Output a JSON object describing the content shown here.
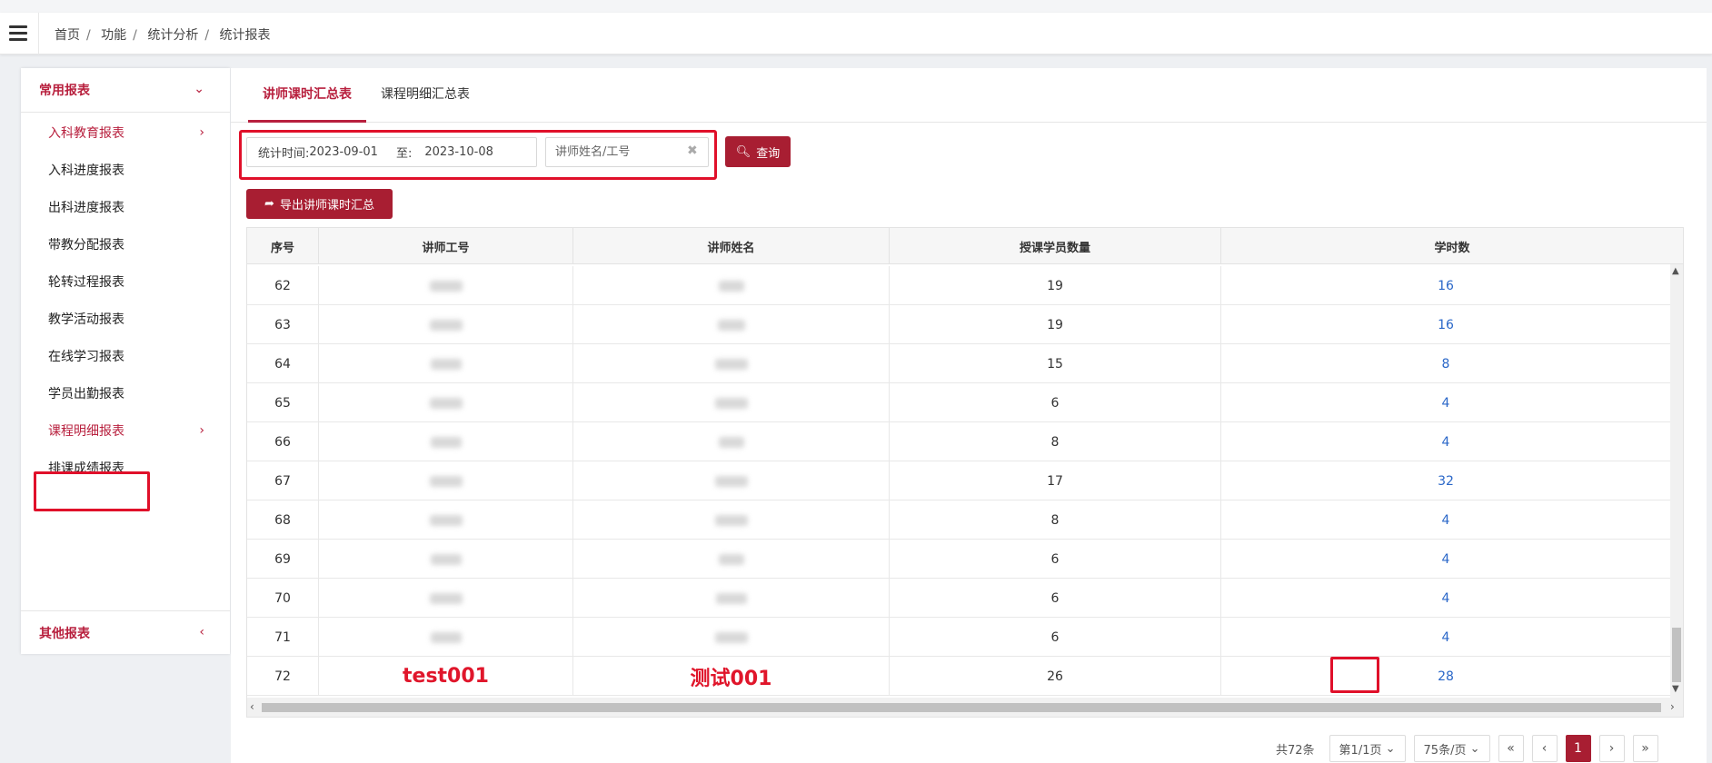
{
  "breadcrumb": [
    "首页",
    "功能",
    "统计分析",
    "统计报表"
  ],
  "sidebar": {
    "group1": "常用报表",
    "group2": "其他报表",
    "items": [
      {
        "label": "入科教育报表",
        "active": true,
        "arrow": true
      },
      {
        "label": "入科进度报表"
      },
      {
        "label": "出科进度报表"
      },
      {
        "label": "带教分配报表"
      },
      {
        "label": "轮转过程报表"
      },
      {
        "label": "教学活动报表"
      },
      {
        "label": "在线学习报表"
      },
      {
        "label": "学员出勤报表"
      },
      {
        "label": "课程明细报表",
        "active": true,
        "arrow": true,
        "highlighted": true
      },
      {
        "label": "排课成绩报表"
      }
    ]
  },
  "tabs": [
    {
      "label": "讲师课时汇总表",
      "active": true
    },
    {
      "label": "课程明细汇总表"
    }
  ],
  "filter": {
    "date_label": "统计时间:",
    "start_date": "2023-09-01",
    "to_label": "至:",
    "end_date": "2023-10-08",
    "search_placeholder": "讲师姓名/工号",
    "query_label": "查询"
  },
  "export_label": "导出讲师课时汇总",
  "table": {
    "columns": [
      "序号",
      "讲师工号",
      "讲师姓名",
      "授课学员数量",
      "学时数"
    ],
    "rows": [
      {
        "no": "62",
        "id": "",
        "name": "",
        "students": "19",
        "hours": "16"
      },
      {
        "no": "63",
        "id": "",
        "name": "",
        "students": "19",
        "hours": "16"
      },
      {
        "no": "64",
        "id": "",
        "name": "",
        "students": "15",
        "hours": "8"
      },
      {
        "no": "65",
        "id": "",
        "name": "",
        "students": "6",
        "hours": "4"
      },
      {
        "no": "66",
        "id": "",
        "name": "",
        "students": "8",
        "hours": "4"
      },
      {
        "no": "67",
        "id": "",
        "name": "",
        "students": "17",
        "hours": "32"
      },
      {
        "no": "68",
        "id": "",
        "name": "",
        "students": "8",
        "hours": "4"
      },
      {
        "no": "69",
        "id": "",
        "name": "",
        "students": "6",
        "hours": "4"
      },
      {
        "no": "70",
        "id": "",
        "name": "",
        "students": "6",
        "hours": "4"
      },
      {
        "no": "71",
        "id": "",
        "name": "",
        "students": "6",
        "hours": "4"
      },
      {
        "no": "72",
        "id": "test001",
        "name": "测试001",
        "students": "26",
        "hours": "28",
        "highlighted": true
      }
    ]
  },
  "pagination": {
    "total": "共72条",
    "page_select": "第1/1页",
    "size_select": "75条/页",
    "first": "«",
    "prev": "‹",
    "current": "1",
    "next": "›",
    "last": "»"
  },
  "colors": {
    "brand": "#a81e32",
    "accent_text": "#b8203e",
    "annotation": "#e0102a",
    "link": "#2a67c8"
  }
}
